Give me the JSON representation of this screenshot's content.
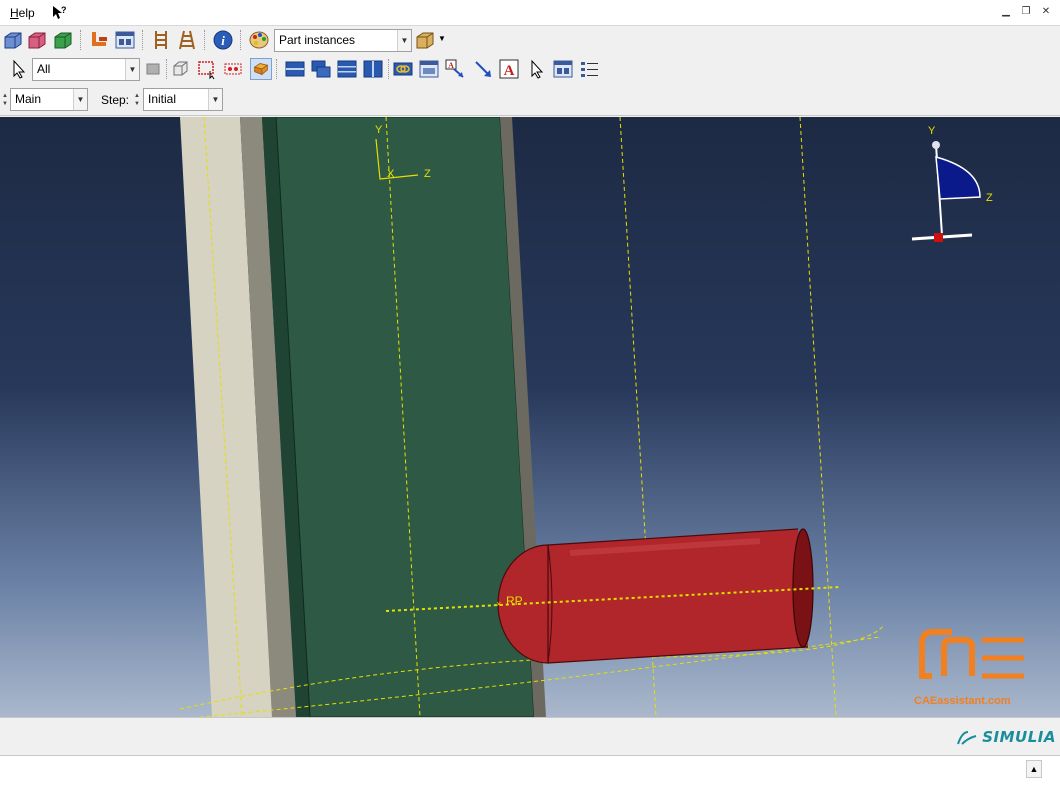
{
  "menubar": {
    "help": "Help",
    "help_underline": "H",
    "help_rest": "elp"
  },
  "toolbar": {
    "display_group_label": "Part instances",
    "selection_filter": "All"
  },
  "context": {
    "model_value": "Main",
    "step_label": "Step:",
    "step_value": "Initial"
  },
  "viewport": {
    "csys_y": "Y",
    "csys_x": "X",
    "csys_z": "Z",
    "triad_y": "Y",
    "triad_z": "Z",
    "rp_label": "RP"
  },
  "colors": {
    "green_part": "#2e5a45",
    "beige_plate": "#d6d3c2",
    "red_cylinder": "#b0262a",
    "datum_yellow": "#e4e000"
  },
  "brand": {
    "simulia": "SIMULIA"
  },
  "watermark": {
    "text": "CAEassistant.com"
  }
}
